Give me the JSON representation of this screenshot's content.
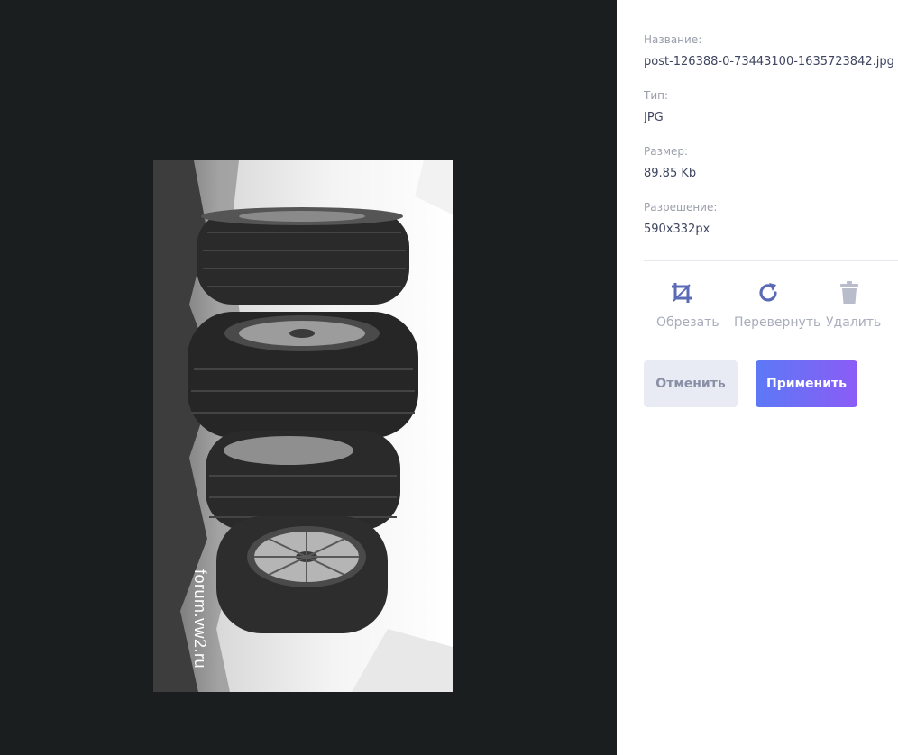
{
  "image": {
    "watermark": "forum.vw2.ru"
  },
  "info": {
    "name_label": "Название:",
    "name_value": "post-126388-0-73443100-1635723842.jpg",
    "type_label": "Тип:",
    "type_value": "JPG",
    "size_label": "Размер:",
    "size_value": "89.85 Kb",
    "resolution_label": "Разрешение:",
    "resolution_value": "590x332px"
  },
  "tools": {
    "crop_label": "Обрезать",
    "crop_icon": "crop-icon",
    "rotate_label": "Перевернуть",
    "rotate_icon": "rotate-icon",
    "delete_label": "Удалить",
    "delete_icon": "trash-icon",
    "active_color": "#5b6ab6",
    "inactive_color": "#b8bccb"
  },
  "actions": {
    "cancel_label": "Отменить",
    "apply_label": "Применить"
  }
}
